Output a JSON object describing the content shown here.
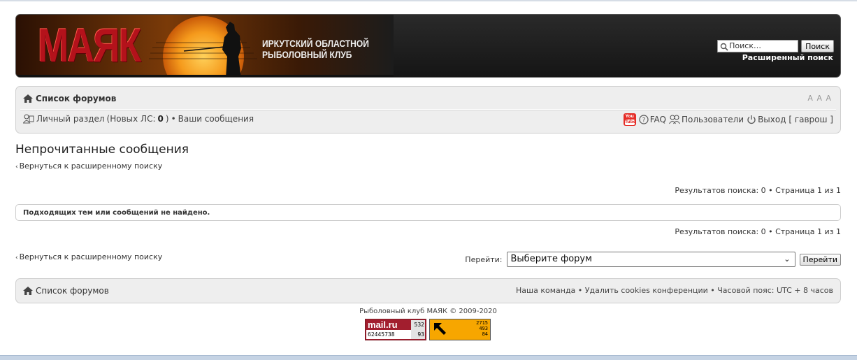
{
  "header": {
    "logo": "МАЯК",
    "club_name": "ИРКУТСКИЙ ОБЛАСТНОЙ\nРЫБОЛОВНЫЙ КЛУБ",
    "search_placeholder": "Поиск…",
    "search_button": "Поиск",
    "advanced_search": "Расширенный поиск"
  },
  "nav": {
    "forum_index": "Список форумов",
    "font_resize": "A A A",
    "personal_section": "Личный раздел",
    "new_pm_prefix": "(Новых ЛС:",
    "new_pm_count": "0",
    "new_pm_suffix": ")",
    "separator": "•",
    "your_posts": "Ваши сообщения",
    "faq": "FAQ",
    "users": "Пользователи",
    "logout": "Выход [ гаврош ]"
  },
  "main": {
    "title": "Непрочитанные сообщения",
    "back_link": "Вернуться к расширенному поиску",
    "results": "Результатов поиска: 0 • Страница 1 из 1",
    "no_results": "Подходящих тем или сообщений не найдено.",
    "jump_label": "Перейти:",
    "jump_select": "Выберите форум",
    "jump_button": "Перейти"
  },
  "footer": {
    "forum_index": "Список форумов",
    "links": "Наша команда • Удалить cookies конференции • Часовой пояс: UTC + 8 часов",
    "copyright": "Рыболовный клуб МАЯК © 2009-2020"
  },
  "counters": {
    "mail_brand": "mail.ru",
    "mail_n1": "532",
    "mail_n2": "62445738",
    "mail_n3": "93",
    "li_nums": "2715\n493\n84"
  },
  "colors": {
    "header_bg": "#1c1c1c",
    "logo_red": "#b4121b",
    "panel_bg": "#eeeeee",
    "sun_orange": "#f59a1c"
  }
}
